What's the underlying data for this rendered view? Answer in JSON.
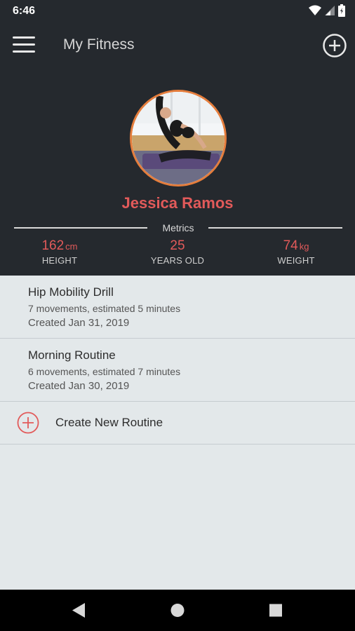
{
  "status_bar": {
    "time": "6:46",
    "icons": [
      "wifi-icon",
      "signal-icon",
      "battery-icon"
    ]
  },
  "app_bar": {
    "title": "My Fitness",
    "menu_icon": "hamburger-menu-icon",
    "add_icon": "add-circle-icon"
  },
  "profile": {
    "name": "Jessica Ramos",
    "metrics_label": "Metrics",
    "height": {
      "value": "162",
      "unit": "cm",
      "label": "HEIGHT"
    },
    "age": {
      "value": "25",
      "label": "YEARS OLD"
    },
    "weight": {
      "value": "74",
      "unit": "kg",
      "label": "WEIGHT"
    }
  },
  "routines": [
    {
      "title": "Hip Mobility Drill",
      "summary": "7 movements, estimated 5 minutes",
      "created": "Created Jan 31, 2019"
    },
    {
      "title": "Morning Routine",
      "summary": "6 movements, estimated 7 minutes",
      "created": "Created Jan 30, 2019"
    }
  ],
  "create_routine": {
    "label": "Create New Routine",
    "icon": "add-circle-icon"
  },
  "nav": {
    "back": "back-icon",
    "home": "home-icon",
    "recents": "recents-icon"
  },
  "colors": {
    "accent": "#e25a5a",
    "avatar_ring": "#e57d3c",
    "header_bg": "#25292e",
    "list_bg": "#e3e8ea"
  }
}
